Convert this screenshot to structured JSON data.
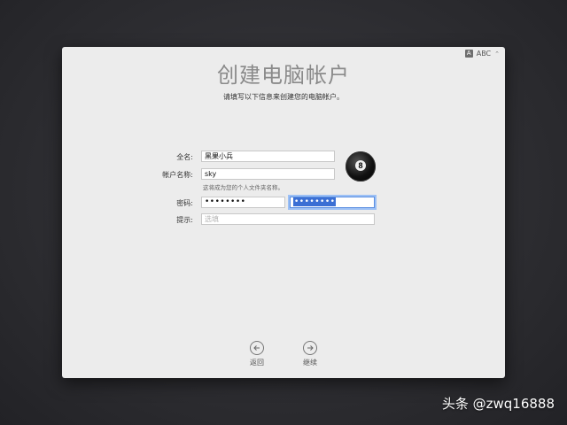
{
  "input_menu": {
    "source_letter": "A",
    "source_name": "ABC"
  },
  "header": {
    "title": "创建电脑帐户",
    "subtitle": "请填写以下信息来创建您的电脑帐户。"
  },
  "form": {
    "full_name": {
      "label": "全名:",
      "value": "黑果小兵"
    },
    "account_name": {
      "label": "帐户名称:",
      "value": "sky",
      "hint": "这将成为您的个人文件夹名称。"
    },
    "password": {
      "label": "密码:",
      "value": "••••••••",
      "verify_value": "••••••••"
    },
    "password_hint": {
      "label": "提示:",
      "placeholder": "选填"
    }
  },
  "avatar": {
    "ball_number": "8"
  },
  "nav": {
    "back_label": "返回",
    "continue_label": "继续"
  },
  "watermark": "头条 @zwq16888",
  "colors": {
    "focus": "#5b8ee0",
    "selection": "#3b6fd4",
    "window_bg": "#ececec"
  }
}
